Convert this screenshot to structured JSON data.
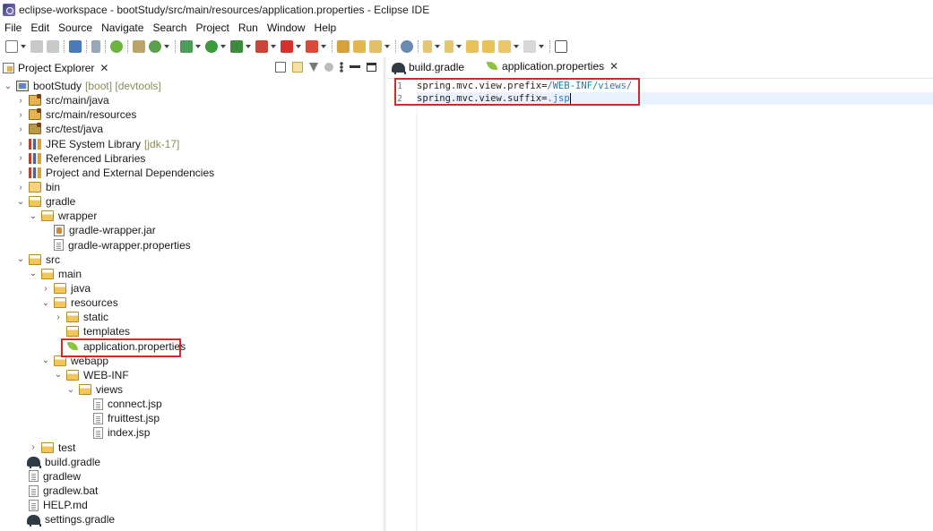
{
  "window": {
    "title": "eclipse-workspace - bootStudy/src/main/resources/application.properties - Eclipse IDE"
  },
  "menubar": [
    "File",
    "Edit",
    "Source",
    "Navigate",
    "Search",
    "Project",
    "Run",
    "Window",
    "Help"
  ],
  "explorer": {
    "tab_label": "Project Explorer",
    "tree": [
      {
        "label": "bootStudy",
        "deco": "[boot] [devtools]",
        "expanded": true,
        "icon": "project-icon"
      },
      {
        "label": "src/main/java",
        "icon": "source-folder-icon"
      },
      {
        "label": "src/main/resources",
        "icon": "source-folder-icon"
      },
      {
        "label": "src/test/java",
        "icon": "source-folder-icon"
      },
      {
        "label": "JRE System Library",
        "deco": "[jdk-17]",
        "icon": "library-icon"
      },
      {
        "label": "Referenced Libraries",
        "icon": "library-icon"
      },
      {
        "label": "Project and External Dependencies",
        "icon": "library-icon"
      },
      {
        "label": "bin",
        "icon": "folder-icon"
      },
      {
        "label": "gradle",
        "icon": "folder-icon"
      },
      {
        "label": "wrapper",
        "icon": "folder-icon"
      },
      {
        "label": "gradle-wrapper.jar",
        "icon": "jar-icon"
      },
      {
        "label": "gradle-wrapper.properties",
        "icon": "file-icon"
      },
      {
        "label": "src",
        "icon": "folder-icon"
      },
      {
        "label": "main",
        "icon": "folder-icon"
      },
      {
        "label": "java",
        "icon": "folder-icon"
      },
      {
        "label": "resources",
        "icon": "folder-icon"
      },
      {
        "label": "static",
        "icon": "folder-icon"
      },
      {
        "label": "templates",
        "icon": "folder-icon"
      },
      {
        "label": "application.properties",
        "icon": "spring-leaf-icon"
      },
      {
        "label": "webapp",
        "icon": "folder-icon"
      },
      {
        "label": "WEB-INF",
        "icon": "folder-icon"
      },
      {
        "label": "views",
        "icon": "folder-icon"
      },
      {
        "label": "connect.jsp",
        "icon": "file-icon"
      },
      {
        "label": "fruittest.jsp",
        "icon": "file-icon"
      },
      {
        "label": "index.jsp",
        "icon": "file-icon"
      },
      {
        "label": "test",
        "icon": "folder-icon"
      },
      {
        "label": "build.gradle",
        "icon": "gradle-icon"
      },
      {
        "label": "gradlew",
        "icon": "file-icon"
      },
      {
        "label": "gradlew.bat",
        "icon": "file-icon"
      },
      {
        "label": "HELP.md",
        "icon": "file-icon"
      },
      {
        "label": "settings.gradle",
        "icon": "gradle-icon"
      }
    ]
  },
  "editor": {
    "tabs": [
      {
        "label": "build.gradle",
        "icon": "gradle-icon",
        "active": false
      },
      {
        "label": "application.properties",
        "icon": "spring-leaf-icon",
        "active": true
      }
    ],
    "lines": [
      {
        "num": "1",
        "key": "spring.mvc.view.prefix=",
        "value": "/WEB-INF/views/"
      },
      {
        "num": "2",
        "key": "spring.mvc.view.suffix=",
        "value": ".jsp"
      }
    ]
  },
  "colors": {
    "highlight": "#d22a2a",
    "property_value": "#2a7aa8",
    "project_decoration": "#8b8b5a"
  }
}
